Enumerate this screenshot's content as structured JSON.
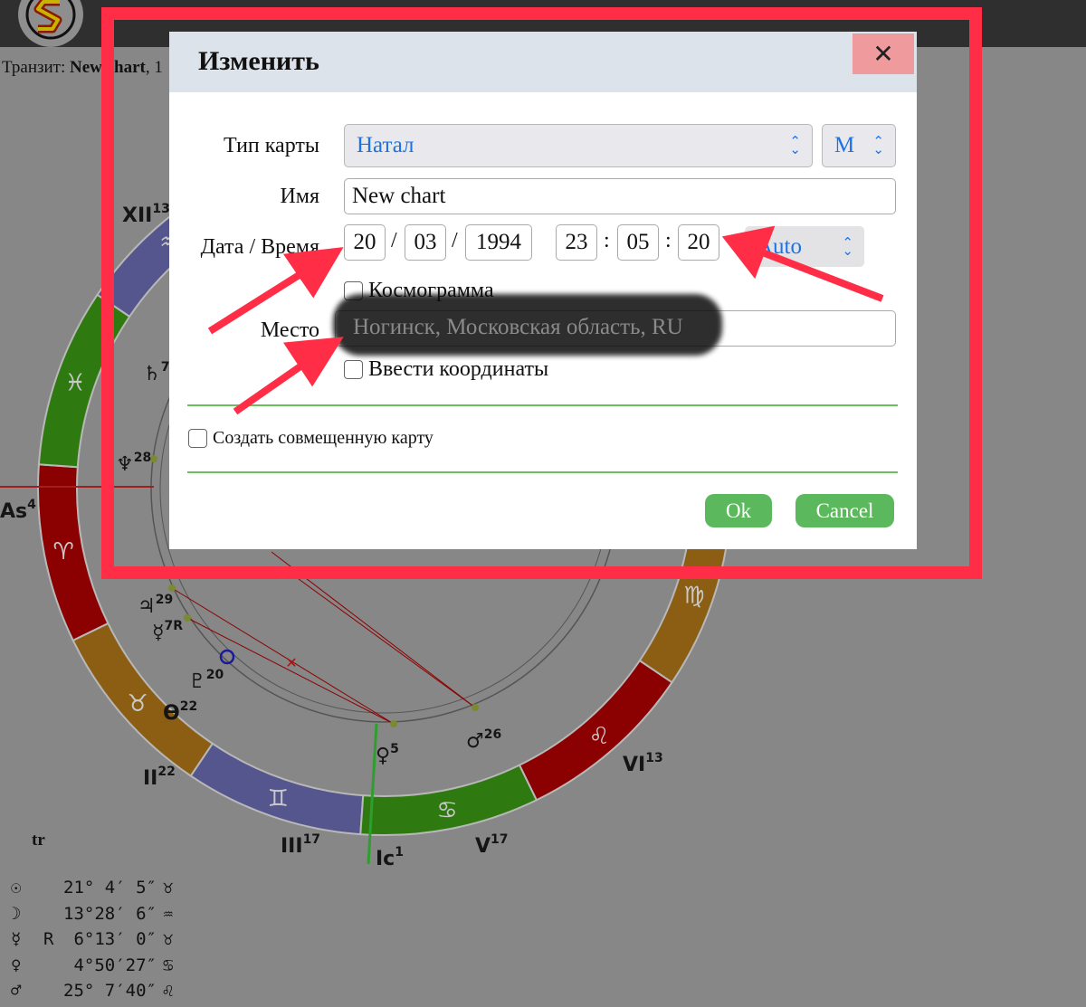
{
  "header": {
    "logo": "S",
    "transit_prefix": "Транзит: ",
    "transit_name": "New chart",
    "transit_suffix": ", 1"
  },
  "chart": {
    "tr_label": "tr",
    "signs": [
      "♈",
      "♉",
      "♊",
      "♋",
      "♌",
      "♍",
      "♎",
      "♏",
      "♐",
      "♑",
      "♒",
      "♓"
    ],
    "sign_colors": {
      "fire": "#8b0000",
      "earth": "#8b5e14",
      "air": "#56568f",
      "water": "#2f7a10"
    },
    "labels": [
      {
        "glyph": "XII",
        "deg": "13"
      },
      {
        "glyph": "As",
        "deg": "4"
      },
      {
        "glyph": "♄",
        "deg": "7"
      },
      {
        "glyph": "♆",
        "deg": "28"
      },
      {
        "glyph": "♃",
        "deg": "29"
      },
      {
        "glyph": "☿",
        "deg": "7R"
      },
      {
        "glyph": "♇",
        "deg": "20"
      },
      {
        "glyph": "ϴ",
        "deg": "22"
      },
      {
        "glyph": "II",
        "deg": "22"
      },
      {
        "glyph": "III",
        "deg": "17"
      },
      {
        "glyph": "Ic",
        "deg": "1"
      },
      {
        "glyph": "♀",
        "deg": "5"
      },
      {
        "glyph": "♂",
        "deg": "26"
      },
      {
        "glyph": "V",
        "deg": "17"
      },
      {
        "glyph": "VI",
        "deg": "13"
      }
    ]
  },
  "positions": [
    {
      "planet": "☉",
      "retro": "",
      "value": "21° 4′ 5″",
      "sign": "♉"
    },
    {
      "planet": "☽",
      "retro": "",
      "value": "13°28′ 6″",
      "sign": "♒"
    },
    {
      "planet": "☿",
      "retro": "R",
      "value": " 6°13′ 0″",
      "sign": "♉"
    },
    {
      "planet": "♀",
      "retro": "",
      "value": " 4°50′27″",
      "sign": "♋"
    },
    {
      "planet": "♂",
      "retro": "",
      "value": "25° 7′40″",
      "sign": "♌"
    }
  ],
  "dialog": {
    "title": "Изменить",
    "close": "✕",
    "chart_type_label": "Тип карты",
    "chart_type_value": "Натал",
    "gender_value": "М",
    "name_label": "Имя",
    "name_value": "New chart",
    "datetime_label": "Дата / Время",
    "day": "20",
    "month": "03",
    "year": "1994",
    "hour": "23",
    "minute": "05",
    "second": "20",
    "date_sep": "/",
    "time_sep": ":",
    "timezone_value": "Auto",
    "cosmogram_label": "Космограмма",
    "place_label": "Место",
    "place_value": "Ногинск, Московская область, RU",
    "coords_label": "Ввести координаты",
    "combined_label": "Создать совмещенную карту",
    "ok": "Ok",
    "cancel": "Cancel"
  },
  "annotation": {
    "color": "#ff2d45"
  }
}
